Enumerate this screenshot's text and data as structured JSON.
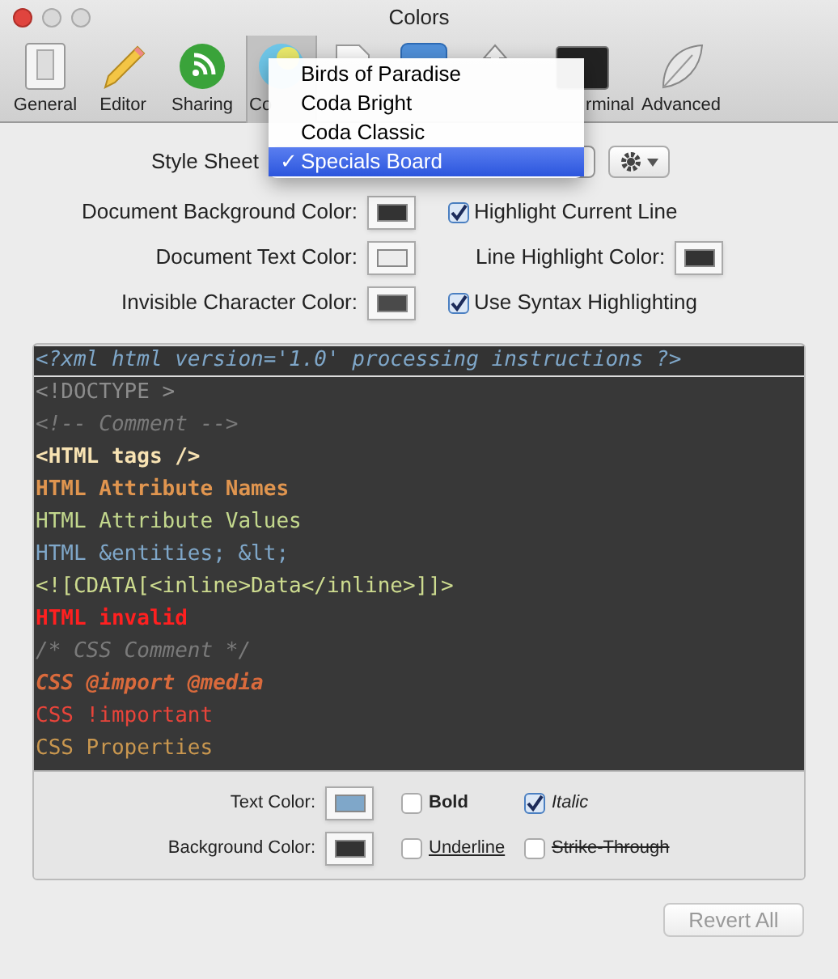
{
  "window": {
    "title": "Colors"
  },
  "toolbar": {
    "items": [
      {
        "label": "General",
        "selected": false
      },
      {
        "label": "Editor",
        "selected": false
      },
      {
        "label": "Sharing",
        "selected": false
      },
      {
        "label": "Co",
        "selected": true
      },
      {
        "selected": false
      },
      {
        "selected": false
      },
      {
        "selected": false
      },
      {
        "label": "rminal",
        "selected": false
      },
      {
        "label": "Advanced",
        "selected": false
      }
    ]
  },
  "style_sheet": {
    "label": "Style Sheet",
    "menu": [
      {
        "label": "Birds of Paradise",
        "selected": false
      },
      {
        "label": "Coda Bright",
        "selected": false
      },
      {
        "label": "Coda Classic",
        "selected": false
      },
      {
        "label": "Specials Board",
        "selected": true,
        "check": "✓"
      }
    ]
  },
  "settings_left": [
    {
      "label": "Document Background Color:",
      "color": "#333333"
    },
    {
      "label": "Document Text Color:",
      "color": "#ececec"
    },
    {
      "label": "Invisible Character Color:",
      "color": "#4a4a4a"
    }
  ],
  "settings_right": [
    {
      "kind": "checkbox",
      "label": "Highlight Current Line",
      "checked": true
    },
    {
      "kind": "color",
      "label": "Line Highlight Color:",
      "color": "#333333"
    },
    {
      "kind": "checkbox",
      "label": "Use Syntax Highlighting",
      "checked": true
    }
  ],
  "code_lines": [
    {
      "text": "<?xml html version='1.0' processing instructions ?>",
      "color": "#7fa7c9",
      "bold": false,
      "italic": true,
      "selected": true
    },
    {
      "text": "<!DOCTYPE >",
      "color": "#8c8c8c",
      "bold": false,
      "italic": false,
      "selected": false
    },
    {
      "text": "<!-- Comment -->",
      "color": "#7a7a7a",
      "bold": false,
      "italic": true,
      "selected": false
    },
    {
      "text": "<HTML tags />",
      "color": "#f8e3b3",
      "bold": true,
      "italic": false,
      "selected": false
    },
    {
      "text": "HTML Attribute Names",
      "color": "#e0954f",
      "bold": true,
      "italic": false,
      "selected": false
    },
    {
      "text": "HTML Attribute Values",
      "color": "#c3d88d",
      "bold": false,
      "italic": false,
      "selected": false
    },
    {
      "text": "HTML &entities; &lt;",
      "color": "#7fa7c9",
      "bold": false,
      "italic": false,
      "selected": false
    },
    {
      "text": "<![CDATA[<inline>Data</inline>]]>",
      "color": "#cddb8f",
      "bold": false,
      "italic": false,
      "selected": false
    },
    {
      "text": "HTML invalid",
      "color": "#ff2020",
      "bold": true,
      "italic": false,
      "selected": false
    },
    {
      "text": "/* CSS Comment */",
      "color": "#7a7a7a",
      "bold": false,
      "italic": true,
      "selected": false
    },
    {
      "text": "CSS @import @media",
      "color": "#d96a3c",
      "bold": true,
      "italic": true,
      "selected": false
    },
    {
      "text": "CSS !important",
      "color": "#e8443a",
      "bold": false,
      "italic": false,
      "selected": false
    },
    {
      "text": "CSS Properties",
      "color": "#c9974f",
      "bold": false,
      "italic": false,
      "selected": false
    }
  ],
  "style_panel": {
    "text_color": {
      "label": "Text Color:",
      "color": "#7fa7c9"
    },
    "background_color": {
      "label": "Background Color:",
      "color": "#333333"
    },
    "options": [
      {
        "kind": "bold",
        "label": "Bold",
        "checked": false
      },
      {
        "kind": "italic",
        "label": "Italic",
        "checked": true
      },
      {
        "kind": "underline",
        "label": "Underline",
        "checked": false
      },
      {
        "kind": "strike",
        "label": "Strike-Through",
        "checked": false
      }
    ]
  },
  "revert_button": {
    "label": "Revert All",
    "disabled": true
  }
}
